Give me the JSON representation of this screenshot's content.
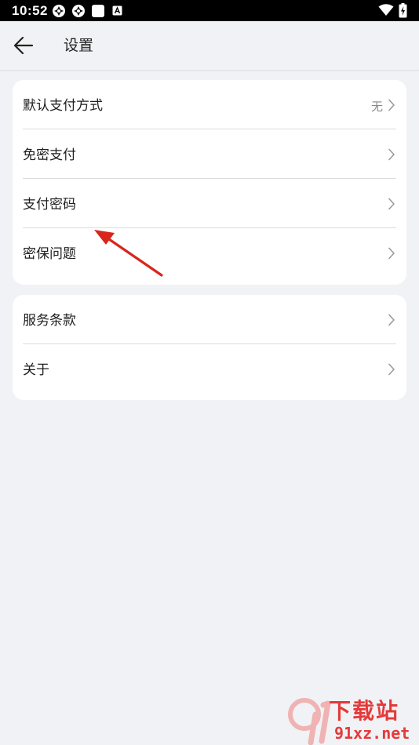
{
  "status_bar": {
    "time": "10:52",
    "notification_icons": [
      "sync-icon",
      "sync-icon",
      "square-icon",
      "font-icon"
    ],
    "system_icons": [
      "wifi-icon",
      "battery-charging-icon"
    ]
  },
  "header": {
    "back_icon": "arrow-left-icon",
    "title": "设置"
  },
  "groups": [
    {
      "items": [
        {
          "label": "默认支付方式",
          "value": "无"
        },
        {
          "label": "免密支付"
        },
        {
          "label": "支付密码"
        },
        {
          "label": "密保问题"
        }
      ]
    },
    {
      "items": [
        {
          "label": "服务条款"
        },
        {
          "label": "关于"
        }
      ]
    }
  ],
  "annotation": {
    "color": "#d9261c"
  },
  "watermark": {
    "text": "下载站",
    "url": "91xz.net",
    "color": "#e33a3a"
  }
}
